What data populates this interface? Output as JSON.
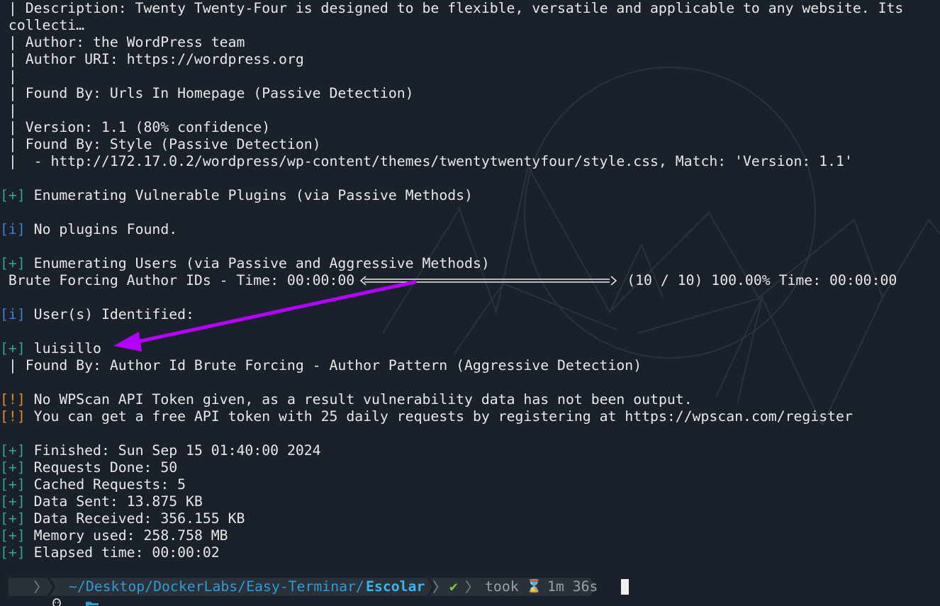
{
  "terminal": {
    "lines": {
      "l0": " | Description: Twenty Twenty-Four is designed to be flexible, versatile and applicable to any website. Its",
      "l1": " collecti…",
      "l2": " | Author: the WordPress team",
      "l3": " | Author URI: https://wordpress.org",
      "l4": " |",
      "l5": " | Found By: Urls In Homepage (Passive Detection)",
      "l6": " |",
      "l7": " | Version: 1.1 (80% confidence)",
      "l8": " | Found By: Style (Passive Detection)",
      "l9": " |  - http://172.17.0.2/wordpress/wp-content/themes/twentytwentyfour/style.css, Match: 'Version: 1.1'",
      "l11": " Enumerating Vulnerable Plugins (via Passive Methods)",
      "l13": " No plugins Found.",
      "l15": " Enumerating Users (via Passive and Aggressive Methods)",
      "l16a": " Brute Forcing Author IDs - Time: 00:00:00",
      "l16b": "(10 / 10) 100.00% Time: 00:00:00",
      "l18": " User(s) Identified:",
      "l20": " luisillo",
      "l21": " | Found By: Author Id Brute Forcing - Author Pattern (Aggressive Detection)",
      "l23": " No WPScan API Token given, as a result vulnerability data has not been output.",
      "l24": " You can get a free API token with 25 daily requests by registering at https://wpscan.com/register",
      "l26": " Finished: Sun Sep 15 01:40:00 2024",
      "l27": " Requests Done: 50",
      "l28": " Cached Requests: 5",
      "l29": " Data Sent: 13.875 KB",
      "l30": " Data Received: 356.155 KB",
      "l31": " Memory used: 258.758 MB",
      "l32": " Elapsed time: 00:00:02"
    },
    "tags": {
      "plus_open": "[",
      "plus_sym": "+",
      "plus_close": "]",
      "info_sym": "i",
      "warn_sym": "!"
    },
    "progress": {
      "fraction": 1.0
    }
  },
  "prompt": {
    "os_icon": "linux-tux-icon",
    "folder_icon": "folder-open-icon",
    "path_prefix": "~/Desktop/DockerLabs/Easy-Terminar/",
    "path_current": "Escolar",
    "status_icon": "✔",
    "took_label": "took",
    "hourglass_icon": "⌛",
    "duration": "1m 36s"
  },
  "colors": {
    "background": "#1b212a",
    "foreground": "#e8e8e8",
    "tag_plus": "#2fa39a",
    "tag_info": "#3f7fd6",
    "tag_warn": "#e08a2e",
    "annotation_arrow": "#b400ff",
    "path": "#2e9bd6",
    "ok": "#7ec93a"
  },
  "annotation": {
    "arrow_icon": "annotation-arrow-icon"
  }
}
